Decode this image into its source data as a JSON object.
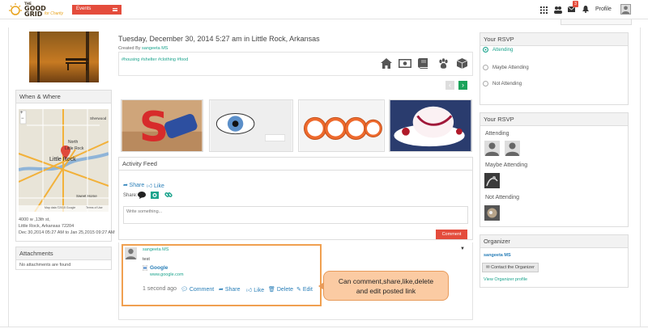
{
  "header": {
    "logo_the": "THE",
    "logo_good": "GOOD",
    "logo_grid": "GRID",
    "logo_sub": "for Charity",
    "events_label": "Events",
    "notification_count": "3",
    "profile_label": "Profile"
  },
  "event": {
    "title": "Tuesday, December 30, 2014 5:27 am in Little Rock, Arkansas",
    "created_prefix": "Created By",
    "creator": "sangeeta MS",
    "tags": "#housing #shelter #clothing #food"
  },
  "when_where": {
    "heading": "When & Where",
    "address1": "4000 w ,13th st,",
    "address2": "Little Rock, Arkansas 72204",
    "date_range": "Dec 30,2014 05:27 AM to Jan 25,2015 09:27 AM",
    "map_labels": {
      "sherwood": "Sherwood",
      "north": "North",
      "little_rock_top": "Little Rock",
      "little_rock": "Little Rock",
      "sweet_home": "Sweet Home",
      "map_data": "Map data ©2015 Google",
      "terms": "Terms of Use"
    }
  },
  "attachments": {
    "heading": "Attachments",
    "empty": "No attachments are found"
  },
  "activity": {
    "heading": "Activity Feed",
    "share_label": "Share",
    "like_label": "Like",
    "share_prefix": "Share:",
    "placeholder": "Write something...",
    "comment_button": "Comment",
    "post": {
      "author": "sangeeta MS",
      "text": "test",
      "link_title": "Google",
      "link_url": "www.google.com",
      "time": "1 second ago",
      "comment": "Comment",
      "share": "Share",
      "like": "Like",
      "delete": "Delete",
      "edit": "Edit"
    }
  },
  "callout": {
    "line1": "Can comment,share,like,delete",
    "line2": "and edit posted link"
  },
  "rsvp_form": {
    "heading": "Your RSVP",
    "options": [
      "Attending",
      "Maybe Attending",
      "Not Attending"
    ],
    "selected": 0
  },
  "rsvp_list": {
    "heading": "Your RSVP",
    "attending": "Attending",
    "maybe": "Maybe Attending",
    "not": "Not Attending"
  },
  "organizer": {
    "heading": "Organizer",
    "name": "sangeeta MS",
    "contact": "Contact the Organizer",
    "profile_link": "View Organizer profile"
  },
  "colors": {
    "accent": "#1aa38c",
    "brand_red": "#e44c3c",
    "link": "#2a7fb8"
  }
}
